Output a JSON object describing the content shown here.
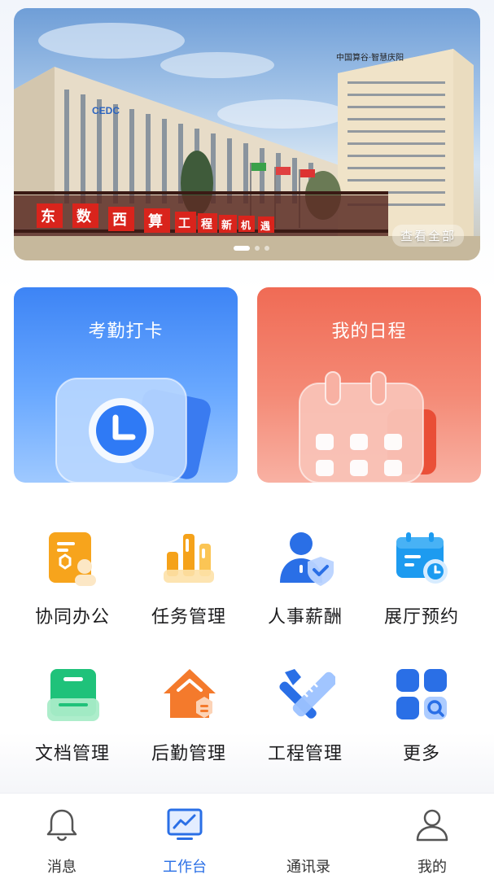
{
  "banner": {
    "view_all_label": "查看全部",
    "slide_count": 3,
    "active_slide": 1,
    "signage": {
      "roof_sign": "中国算谷·智慧庆阳",
      "fence_characters": [
        "东",
        "数",
        "西",
        "算",
        "工",
        "程",
        "新",
        "机",
        "遇"
      ],
      "left_logo": "CEDC"
    }
  },
  "cards": [
    {
      "title": "考勤打卡",
      "icon": "clock-icon",
      "color": "#3d84f5"
    },
    {
      "title": "我的日程",
      "icon": "calendar-icon",
      "color": "#f06b55"
    }
  ],
  "grid": [
    {
      "label": "协同办公",
      "icon": "collaboration-icon"
    },
    {
      "label": "任务管理",
      "icon": "task-chart-icon"
    },
    {
      "label": "人事薪酬",
      "icon": "person-shield-icon"
    },
    {
      "label": "展厅预约",
      "icon": "calendar-clock-icon"
    },
    {
      "label": "文档管理",
      "icon": "document-tray-icon"
    },
    {
      "label": "后勤管理",
      "icon": "house-icon"
    },
    {
      "label": "工程管理",
      "icon": "tools-icon"
    },
    {
      "label": "更多",
      "icon": "apps-grid-icon"
    }
  ],
  "tabbar": {
    "active": "工作台",
    "accent": "#2a6fe6",
    "items": [
      {
        "label": "消息",
        "icon": "bell-icon"
      },
      {
        "label": "工作台",
        "icon": "dashboard-chart-icon"
      },
      {
        "label": "通讯录",
        "icon": "contacts-icon"
      },
      {
        "label": "我的",
        "icon": "user-icon"
      }
    ]
  }
}
